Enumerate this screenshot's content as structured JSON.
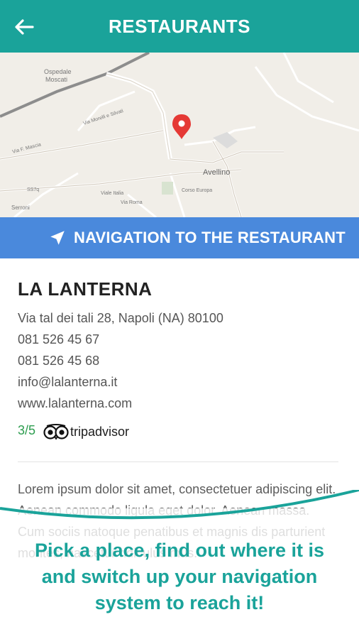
{
  "app_bar": {
    "title": "RESTAURANTS",
    "back_icon": "arrow-left-icon"
  },
  "map": {
    "labels": {
      "ospedale": "Ospedale",
      "moscati": "Moscati",
      "via_morelli": "Via Morelli e Silvati",
      "via_mascia": "Via F. Mascia",
      "sicily": "SS7q",
      "avellino": "Avellino",
      "via_italia": "Viale Italia",
      "viale_europa": "Corso Europa",
      "via_roma": "Via Roma",
      "serroni": "Serroni"
    },
    "marker_icon": "map-pin-icon"
  },
  "navigation_button": {
    "label": "NAVIGATION TO THE RESTAURANT",
    "icon": "navigation-arrow-icon"
  },
  "restaurant": {
    "name": "LA LANTERNA",
    "address": "Via tal dei tali 28, Napoli (NA) 80100",
    "phone1": "081 526 45 67",
    "phone2": "081 526 45 68",
    "email": "info@lalanterna.it",
    "website": "www.lalanterna.com",
    "rating": "3/5",
    "rating_provider": "tripadvisor",
    "description": "Lorem ipsum dolor sit amet, consectetuer adipiscing elit. Aenean commodo ligula eget dolor. Aenean massa. Cum sociis natoque penatibus et magnis dis parturient montes, nascetur ridiculus mus."
  },
  "promo": {
    "line1": "Pick a place, find out where it is",
    "line2": "and switch up your navigation",
    "line3": "system to reach it!"
  },
  "colors": {
    "primary": "#1aa39a",
    "nav_button": "#4a89dc",
    "rating": "#2d9d4f",
    "marker": "#e53935"
  }
}
